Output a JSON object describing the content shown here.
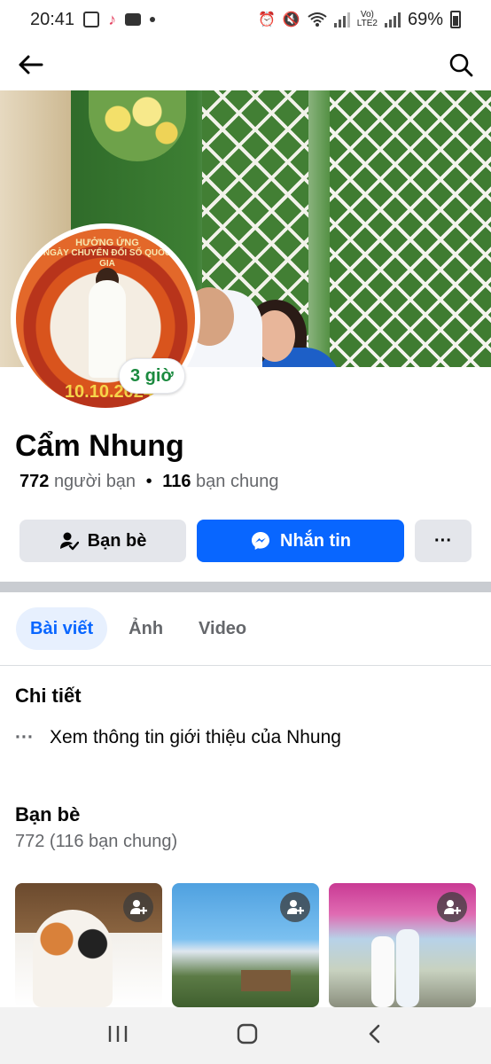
{
  "status_bar": {
    "time": "20:41",
    "network": "LTE2",
    "volte": "Vo)",
    "battery": "69%"
  },
  "nav": {
    "back_icon": "arrow-left-icon",
    "search_icon": "search-icon"
  },
  "avatar": {
    "banner_line1": "HƯỞNG ỨNG",
    "banner_line2": "NGÀY CHUYỂN ĐỔI SỐ QUỐC GIA",
    "date": "10.10.2024"
  },
  "story_badge": "3 giờ",
  "profile": {
    "name": "Cẩm Nhung",
    "friends_count": "772",
    "friends_label": "người bạn",
    "separator": "•",
    "mutual_count": "116",
    "mutual_label": "bạn chung"
  },
  "actions": {
    "friends_label": "Bạn bè",
    "message_label": "Nhắn tin",
    "more_label": "···"
  },
  "tabs": [
    {
      "label": "Bài viết",
      "active": true
    },
    {
      "label": "Ảnh",
      "active": false
    },
    {
      "label": "Video",
      "active": false
    }
  ],
  "details": {
    "title": "Chi tiết",
    "more_icon": "···",
    "intro_text": "Xem thông tin giới thiệu của Nhung"
  },
  "friends": {
    "title": "Bạn bè",
    "subtitle": "772 (116 bạn chung)"
  },
  "colors": {
    "accent": "#0866ff",
    "accent_light": "#e7f0fe",
    "button_gray": "#e4e6eb",
    "story_green": "#1b8a3f",
    "secondary_text": "#65676b"
  }
}
